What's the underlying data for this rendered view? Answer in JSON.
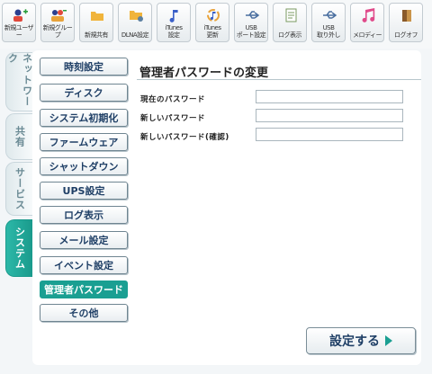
{
  "toolbar": {
    "buttons": [
      {
        "label": "新規ユーザー",
        "icon": "add-user-icon"
      },
      {
        "label": "新規グループ",
        "icon": "add-group-icon"
      },
      {
        "label": "新規共有",
        "icon": "new-share-folder-icon"
      },
      {
        "label": "DLNA設定",
        "icon": "dlna-icon"
      },
      {
        "label": "iTunes\n設定",
        "icon": "itunes-settings-icon"
      },
      {
        "label": "iTunes\n更新",
        "icon": "itunes-update-icon"
      },
      {
        "label": "USB\nポート設定",
        "icon": "usb-port-icon"
      },
      {
        "label": "ログ表示",
        "icon": "log-view-icon"
      },
      {
        "label": "USB\n取り外し",
        "icon": "usb-remove-icon"
      },
      {
        "label": "メロディー",
        "icon": "melody-icon"
      },
      {
        "label": "ログオフ",
        "icon": "logoff-icon"
      }
    ]
  },
  "side_tabs": [
    {
      "label": "ネットワーク",
      "active": false
    },
    {
      "label": "共有",
      "active": false
    },
    {
      "label": "サービス",
      "active": false
    },
    {
      "label": "システム",
      "active": true
    }
  ],
  "menu": [
    {
      "label": "時刻設定",
      "active": false
    },
    {
      "label": "ディスク",
      "active": false
    },
    {
      "label": "システム初期化",
      "active": false
    },
    {
      "label": "ファームウェア",
      "active": false
    },
    {
      "label": "シャットダウン",
      "active": false
    },
    {
      "label": "UPS設定",
      "active": false
    },
    {
      "label": "ログ表示",
      "active": false
    },
    {
      "label": "メール設定",
      "active": false
    },
    {
      "label": "イベント設定",
      "active": false
    },
    {
      "label": "管理者パスワード",
      "active": true
    },
    {
      "label": "その他",
      "active": false
    }
  ],
  "form": {
    "title": "管理者パスワードの変更",
    "fields": [
      {
        "label": "現在のパスワード",
        "value": ""
      },
      {
        "label": "新しいパスワード",
        "value": ""
      },
      {
        "label": "新しいパスワード(確認)",
        "value": ""
      }
    ],
    "submit_label": "設定する"
  },
  "colors": {
    "accent": "#1a9f92",
    "menu_text": "#1f3f66"
  }
}
